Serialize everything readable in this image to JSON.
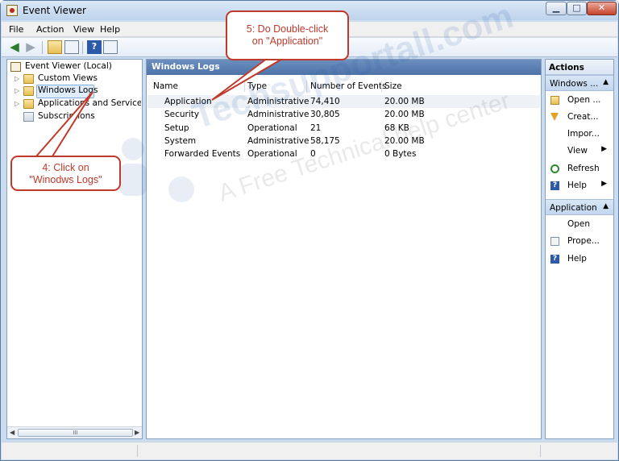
{
  "window": {
    "title": "Event Viewer",
    "controls": {
      "minimize": "▁",
      "maximize": "□",
      "close": "✕"
    }
  },
  "menu": [
    "File",
    "Action",
    "View",
    "Help"
  ],
  "toolbar": {
    "buttons": [
      "back-icon",
      "forward-icon",
      "up-folder-icon",
      "show-hide-console-tree-icon",
      "help-icon",
      "show-hide-action-pane-icon"
    ]
  },
  "tree": {
    "root": "Event Viewer (Local)",
    "items": [
      {
        "label": "Custom Views",
        "icon": "folder-icon",
        "expandable": true
      },
      {
        "label": "Windows Logs",
        "icon": "folder-icon",
        "expandable": true,
        "selected": true
      },
      {
        "label": "Applications and Services Lo",
        "icon": "folder-icon",
        "expandable": true
      },
      {
        "label": "Subscriptions",
        "icon": "subscriptions-icon",
        "expandable": false
      }
    ],
    "scrollbar_thumb": "III"
  },
  "center": {
    "title": "Windows Logs",
    "columns": [
      "Name",
      "Type",
      "Number of Events",
      "Size"
    ],
    "rows": [
      {
        "name": "Application",
        "type": "Administrative",
        "events": "74,410",
        "size": "20.00 MB"
      },
      {
        "name": "Security",
        "type": "Administrative",
        "events": "30,805",
        "size": "20.00 MB"
      },
      {
        "name": "Setup",
        "type": "Operational",
        "events": "21",
        "size": "68 KB"
      },
      {
        "name": "System",
        "type": "Administrative",
        "events": "58,175",
        "size": "20.00 MB"
      },
      {
        "name": "Forwarded Events",
        "type": "Operational",
        "events": "0",
        "size": "0 Bytes"
      }
    ]
  },
  "actions": {
    "title": "Actions",
    "section1": {
      "title": "Windows ...",
      "items": [
        {
          "label": "Open ...",
          "icon": "open-folder-icon"
        },
        {
          "label": "Creat...",
          "icon": "filter-icon"
        },
        {
          "label": "Impor...",
          "icon": ""
        },
        {
          "label": "View",
          "icon": "",
          "submenu": true
        },
        {
          "label": "Refresh",
          "icon": "refresh-icon"
        },
        {
          "label": "Help",
          "icon": "help-icon",
          "submenu": true
        }
      ]
    },
    "section2": {
      "title": "Application",
      "items": [
        {
          "label": "Open",
          "icon": ""
        },
        {
          "label": "Prope...",
          "icon": "properties-icon"
        },
        {
          "label": "Help",
          "icon": "help-icon"
        }
      ]
    }
  },
  "annotations": {
    "step5": {
      "line1": "5: Do Double-click",
      "line2": "on \"Application\""
    },
    "step4": {
      "line1": "4: Click on",
      "line2": "\"Winodws Logs\""
    }
  },
  "watermark": {
    "line1": "Techsupportall.com",
    "line2": "A Free Technical help center"
  },
  "colors": {
    "callout": "#c0392b",
    "header_blue": "#5b80b4",
    "selection": "#dfecfb"
  }
}
